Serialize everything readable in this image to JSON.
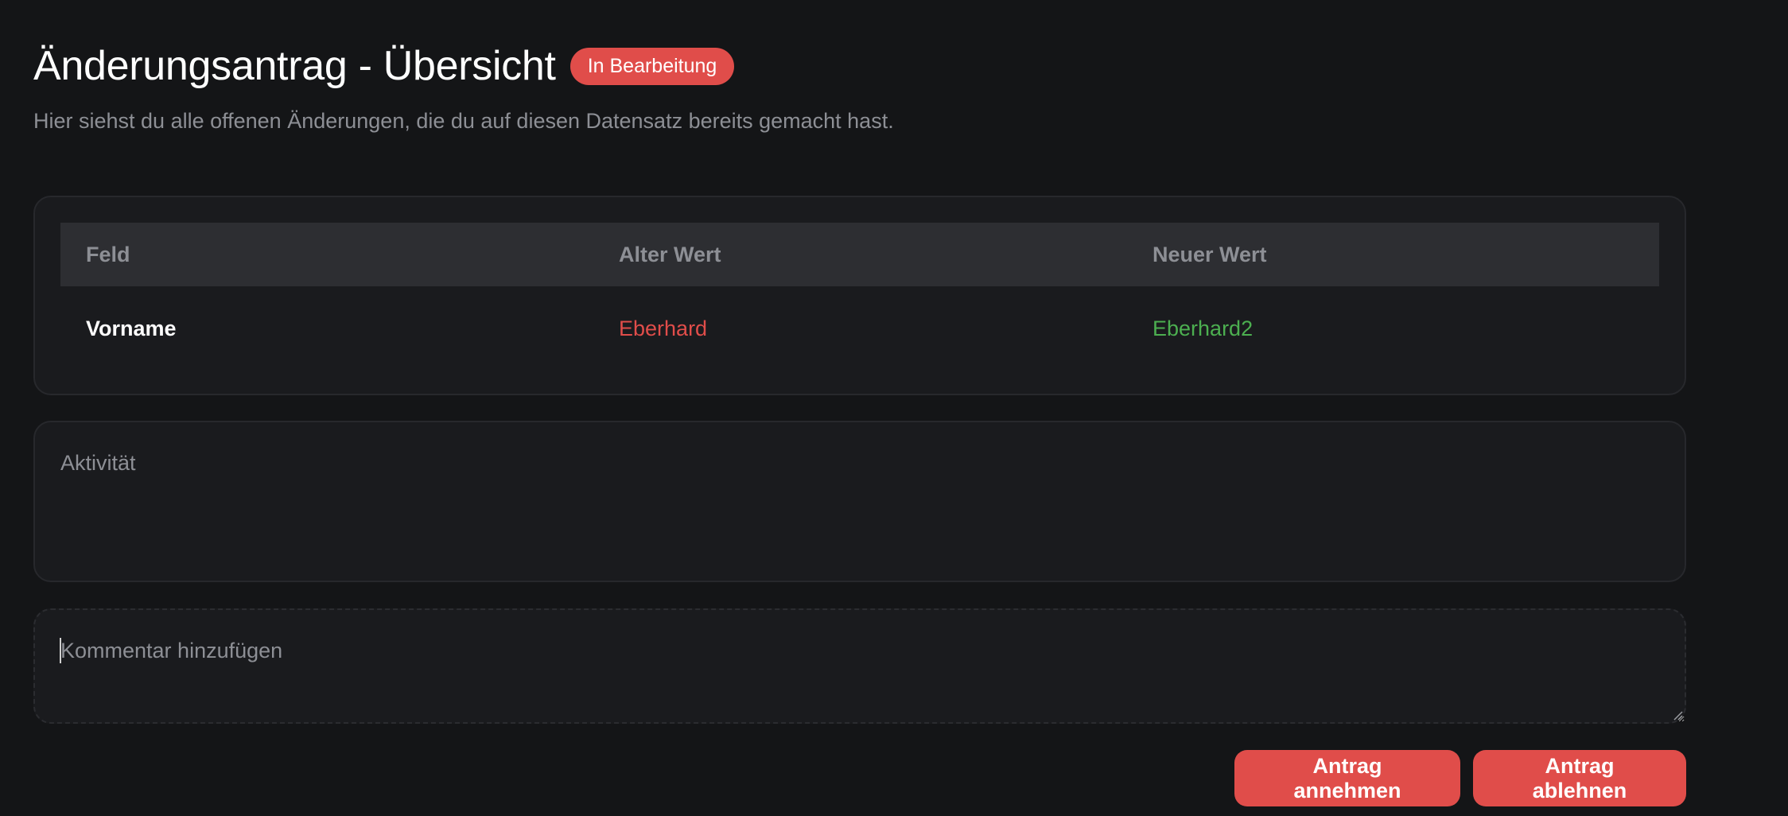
{
  "header": {
    "title": "Änderungsantrag - Übersicht",
    "status_badge": "In Bearbeitung",
    "subtitle": "Hier siehst du alle offenen Änderungen, die du auf diesen Datensatz bereits gemacht hast."
  },
  "changes_table": {
    "columns": [
      "Feld",
      "Alter Wert",
      "Neuer Wert"
    ],
    "rows": [
      {
        "field": "Vorname",
        "old_value": "Eberhard",
        "new_value": "Eberhard2"
      }
    ]
  },
  "activity": {
    "title": "Aktivität"
  },
  "comment": {
    "value": "",
    "placeholder": "Kommentar hinzufügen"
  },
  "actions": {
    "accept_label": "Antrag annehmen",
    "reject_label": "Antrag ablehnen"
  },
  "colors": {
    "background": "#141517",
    "card": "#1a1b1e",
    "accent_red": "#e04d4a",
    "old_value": "#e04d4a",
    "new_value": "#4caf50",
    "muted_text": "#8d8f95"
  }
}
